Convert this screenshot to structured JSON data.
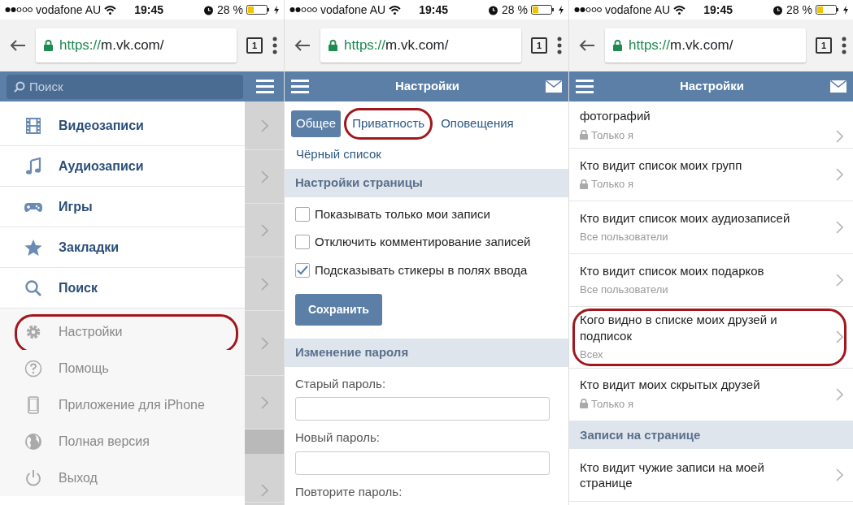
{
  "phones": [
    {
      "kind": "menu",
      "status_bar": {
        "carrier": "vodafone AU",
        "time": "19:45",
        "battery": "28 %"
      },
      "browser": {
        "scheme": "https://",
        "host": "m.vk.com/",
        "tab_count": "1"
      },
      "search": {
        "placeholder": "Поиск"
      },
      "menu_items": [
        {
          "label": "Видеозаписи",
          "muted": false,
          "highlighted": false
        },
        {
          "label": "Аудиозаписи",
          "muted": false,
          "highlighted": false
        },
        {
          "label": "Игры",
          "muted": false,
          "highlighted": false
        },
        {
          "label": "Закладки",
          "muted": false,
          "highlighted": false
        },
        {
          "label": "Поиск",
          "muted": false,
          "highlighted": false
        },
        {
          "label": "Настройки",
          "muted": true,
          "highlighted": true
        },
        {
          "label": "Помощь",
          "muted": true,
          "highlighted": false
        },
        {
          "label": "Приложение для iPhone",
          "muted": true,
          "highlighted": false
        },
        {
          "label": "Полная версия",
          "muted": true,
          "highlighted": false
        },
        {
          "label": "Выход",
          "muted": true,
          "highlighted": false
        }
      ]
    },
    {
      "kind": "settings_form",
      "status_bar": {
        "carrier": "vodafone AU",
        "time": "19:45",
        "battery": "28 %"
      },
      "browser": {
        "scheme": "https://",
        "host": "m.vk.com/",
        "tab_count": "1"
      },
      "title": "Настройки",
      "tabs": [
        {
          "label": "Общее",
          "selected": true,
          "highlighted": false
        },
        {
          "label": "Приватность",
          "selected": false,
          "highlighted": true
        },
        {
          "label": "Оповещения",
          "selected": false,
          "highlighted": false
        },
        {
          "label": "Чёрный список",
          "selected": false,
          "highlighted": false
        }
      ],
      "blocks": [
        {
          "kind": "section",
          "text": "Настройки страницы"
        },
        {
          "kind": "checkbox",
          "text": "Показывать только мои записи",
          "checked": false
        },
        {
          "kind": "checkbox",
          "text": "Отключить комментирование записей",
          "checked": false
        },
        {
          "kind": "checkbox",
          "text": "Подсказывать стикеры в полях ввода",
          "checked": true
        },
        {
          "kind": "button",
          "text": "Сохранить"
        },
        {
          "kind": "section",
          "text": "Изменение пароля"
        },
        {
          "kind": "label",
          "text": "Старый пароль:"
        },
        {
          "kind": "input"
        },
        {
          "kind": "label",
          "text": "Новый пароль:"
        },
        {
          "kind": "input"
        },
        {
          "kind": "label",
          "text": "Повторите пароль:"
        }
      ]
    },
    {
      "kind": "privacy_list",
      "status_bar": {
        "carrier": "vodafone AU",
        "time": "19:45",
        "battery": "28 %"
      },
      "browser": {
        "scheme": "https://",
        "host": "m.vk.com/",
        "tab_count": "1"
      },
      "title": "Настройки",
      "rows": [
        {
          "kind": "setting",
          "title": "фотографий",
          "value": "Только я",
          "locked": true,
          "highlighted": false
        },
        {
          "kind": "setting",
          "title": "Кто видит список моих групп",
          "value": "Только я",
          "locked": true,
          "highlighted": false
        },
        {
          "kind": "setting",
          "title": "Кто видит список моих аудиозаписей",
          "value": "Все пользователи",
          "locked": false,
          "highlighted": false
        },
        {
          "kind": "setting",
          "title": "Кто видит список моих подарков",
          "value": "Все пользователи",
          "locked": false,
          "highlighted": false
        },
        {
          "kind": "setting",
          "title": "Кого видно в списке моих друзей и подписок",
          "value": "Всех",
          "locked": false,
          "highlighted": true
        },
        {
          "kind": "setting",
          "title": "Кто видит моих скрытых друзей",
          "value": "Только я",
          "locked": true,
          "highlighted": false
        },
        {
          "kind": "section",
          "title": "Записи на странице"
        },
        {
          "kind": "setting",
          "title": "Кто видит чужие записи на моей странице"
        }
      ]
    }
  ]
}
